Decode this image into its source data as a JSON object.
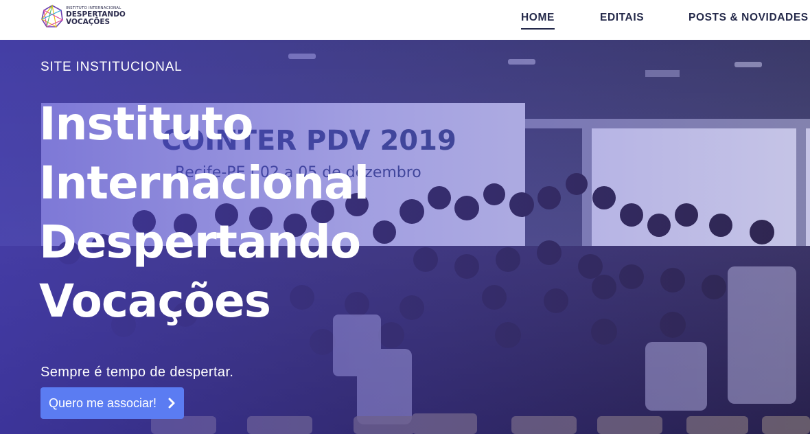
{
  "header": {
    "logo": {
      "line1": "INSTITUTO INTERNACIONAL",
      "line2": "DESPERTANDO",
      "line3": "VOCAÇÕES"
    },
    "nav": [
      {
        "label": "HOME",
        "active": true
      },
      {
        "label": "EDITAIS",
        "active": false
      },
      {
        "label": "POSTS & NOVIDADES",
        "active": false
      }
    ]
  },
  "hero": {
    "eyebrow": "SITE INSTITUCIONAL",
    "title_lines": [
      "Instituto",
      "Internacional",
      "Despertando",
      "Vocações"
    ],
    "subtitle": "Sempre é tempo de despertar.",
    "cta_label": "Quero me associar!",
    "cta_icon": "chevron-right-icon",
    "background_banner": {
      "line1": "COINTER PDV 2019",
      "line2": "Recife-PE | 02 a 05 de dezembro"
    }
  },
  "colors": {
    "nav_text": "#24294a",
    "overlay": "#4840c8",
    "cta_bg": "#5b7cf2"
  }
}
